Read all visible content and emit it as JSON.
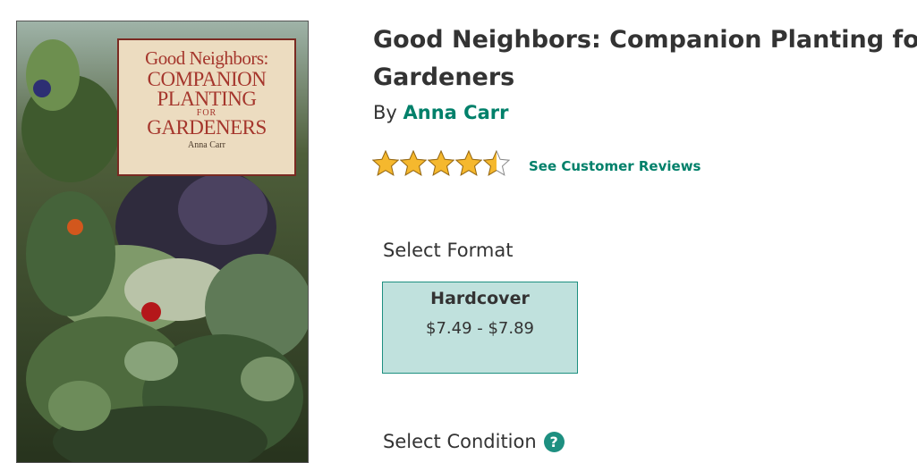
{
  "cover": {
    "line1": "Good Neighbors:",
    "line2": "COMPANION",
    "line3": "PLANTING",
    "line4": "FOR",
    "line5": "GARDENERS",
    "author": "Anna Carr"
  },
  "product": {
    "title": "Good Neighbors: Companion Planting for Gardeners",
    "by_label": "By",
    "author": "Anna Carr",
    "rating": 4.5,
    "rating_max": 5,
    "reviews_link": "See Customer Reviews"
  },
  "format": {
    "label": "Select Format",
    "options": [
      {
        "name": "Hardcover",
        "price": "$7.49 - $7.89",
        "selected": true
      }
    ]
  },
  "condition": {
    "label": "Select Condition",
    "help_icon": "question-mark-icon"
  },
  "colors": {
    "accent": "#00806a",
    "selected_bg": "#c0e1dd",
    "star": "#f5b82e"
  }
}
